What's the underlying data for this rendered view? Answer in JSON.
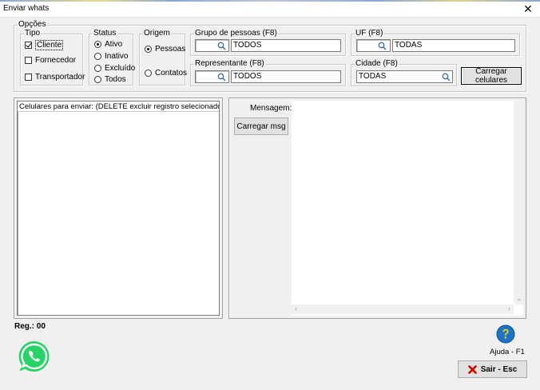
{
  "window": {
    "title": "Enviar whats"
  },
  "options": {
    "legend": "Opções",
    "tipo": {
      "legend": "Tipo",
      "items": [
        {
          "label": "Cliente",
          "checked": true
        },
        {
          "label": "Fornecedor",
          "checked": false
        },
        {
          "label": "Transportador",
          "checked": false
        }
      ]
    },
    "status": {
      "legend": "Status",
      "items": [
        {
          "label": "Ativo",
          "selected": true
        },
        {
          "label": "Inativo",
          "selected": false
        },
        {
          "label": "Excluído",
          "selected": false
        },
        {
          "label": "Todos",
          "selected": false
        }
      ]
    },
    "origem": {
      "legend": "Origem",
      "items": [
        {
          "label": "Pessoas",
          "selected": true
        },
        {
          "label": "Contatos",
          "selected": false
        }
      ]
    },
    "grupo": {
      "legend": "Grupo de pessoas (F8)",
      "value": "TODOS",
      "icon": "search-icon"
    },
    "uf": {
      "legend": "UF (F8)",
      "value": "TODAS",
      "icon": "search-icon"
    },
    "representante": {
      "legend": "Representante (F8)",
      "value": "TODOS",
      "icon": "search-icon"
    },
    "cidade": {
      "legend": "Cidade (F8)",
      "value": "TODAS",
      "icon": "search-icon"
    },
    "load_phones_button": "Carregar celulares"
  },
  "phones_list": {
    "header": "Celulares para enviar: (DELETE excluir registro selecionado)",
    "rows": []
  },
  "message": {
    "label": "Mensagem:",
    "load_button": "Carregar msg",
    "text": ""
  },
  "footer": {
    "reg_label": "Reg.: 00",
    "help_label": "Ajuda - F1",
    "exit_button": "Sair - Esc",
    "icons": {
      "app": "whatsapp-icon",
      "help": "help-icon",
      "exit": "close-icon"
    }
  },
  "colors": {
    "whatsapp": "#25d366",
    "help": "#1e73c8",
    "exit_x": "#d40000"
  }
}
